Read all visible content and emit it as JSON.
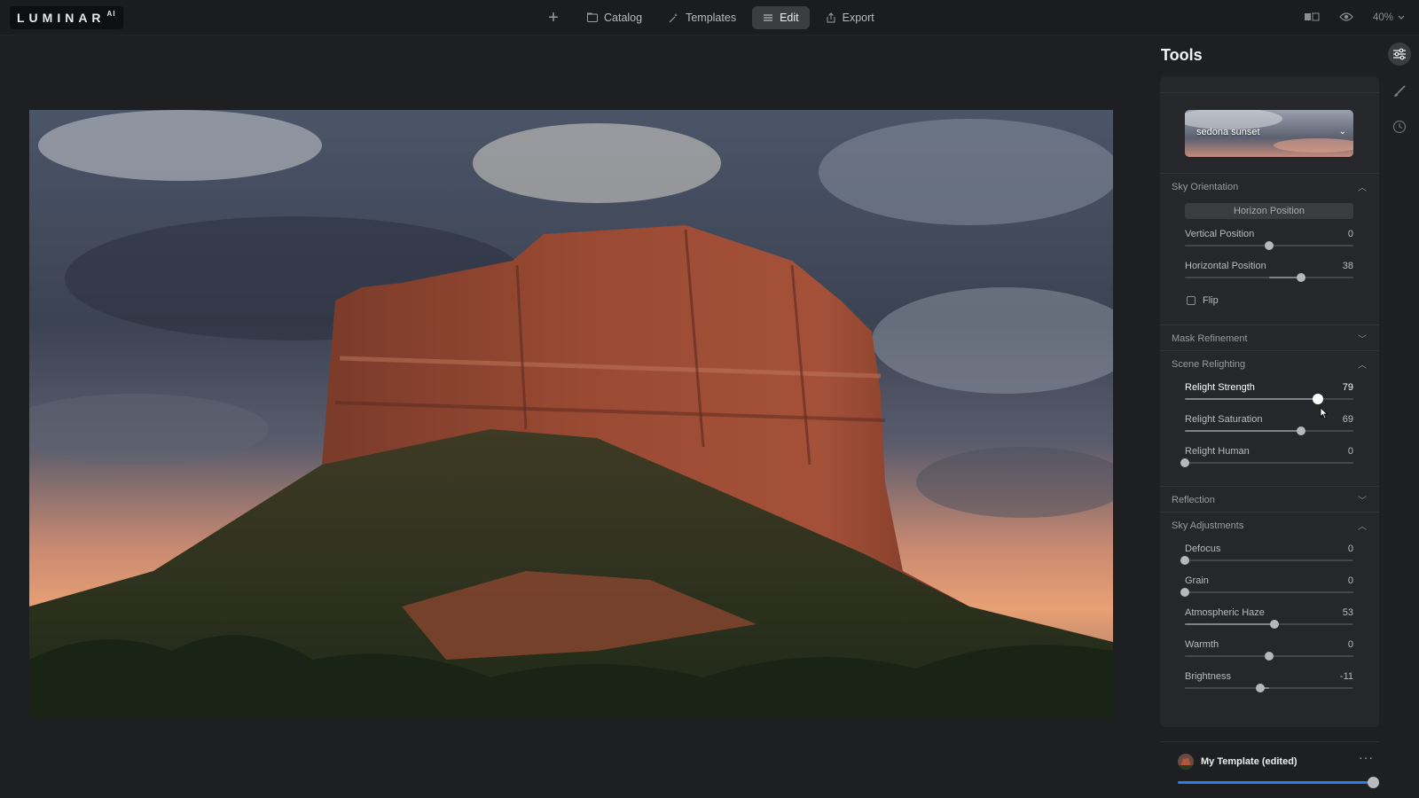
{
  "app": {
    "logo_text": "LUMINAR",
    "logo_suffix": "AI"
  },
  "nav": {
    "catalog": "Catalog",
    "templates": "Templates",
    "edit": "Edit",
    "export": "Export",
    "active": "Edit"
  },
  "view": {
    "zoom": "40%"
  },
  "tools": {
    "title": "Tools",
    "sky_selector": {
      "value": "sedona sunset"
    },
    "sections": {
      "sky_orientation": {
        "title": "Sky Orientation",
        "expanded": true,
        "horizon_button": "Horizon Position",
        "sliders": [
          {
            "label": "Vertical Position",
            "value": "0",
            "fraction": 0.5,
            "bipolar": true
          },
          {
            "label": "Horizontal Position",
            "value": "38",
            "fraction": 0.69,
            "bipolar": true
          }
        ],
        "flip_label": "Flip",
        "flip_checked": false
      },
      "mask_refinement": {
        "title": "Mask Refinement",
        "expanded": false
      },
      "scene_relighting": {
        "title": "Scene Relighting",
        "expanded": true,
        "sliders": [
          {
            "label": "Relight Strength",
            "value": "79",
            "fraction": 0.79,
            "bipolar": false,
            "highlighted": true
          },
          {
            "label": "Relight Saturation",
            "value": "69",
            "fraction": 0.69,
            "bipolar": false
          },
          {
            "label": "Relight Human",
            "value": "0",
            "fraction": 0.0,
            "bipolar": false
          }
        ]
      },
      "reflection": {
        "title": "Reflection",
        "expanded": false
      },
      "sky_adjustments": {
        "title": "Sky Adjustments",
        "expanded": true,
        "sliders": [
          {
            "label": "Defocus",
            "value": "0",
            "fraction": 0.0,
            "bipolar": false
          },
          {
            "label": "Grain",
            "value": "0",
            "fraction": 0.0,
            "bipolar": false
          },
          {
            "label": "Atmospheric Haze",
            "value": "53",
            "fraction": 0.53,
            "bipolar": false
          },
          {
            "label": "Warmth",
            "value": "0",
            "fraction": 0.5,
            "bipolar": true
          },
          {
            "label": "Brightness",
            "value": "-11",
            "fraction": 0.445,
            "bipolar": true
          }
        ]
      }
    }
  },
  "template_bar": {
    "name": "My Template (edited)",
    "amount": 1.0
  },
  "colors": {
    "accent": "#2e7bf0",
    "panel": "#25272a",
    "background": "#1e1f21"
  },
  "icons": [
    "plus-icon",
    "catalog-icon",
    "templates-icon",
    "edit-icon",
    "export-icon",
    "compare-icon",
    "eye-icon",
    "tools-sliders-icon",
    "brush-icon",
    "history-clock-icon",
    "more-icon"
  ]
}
